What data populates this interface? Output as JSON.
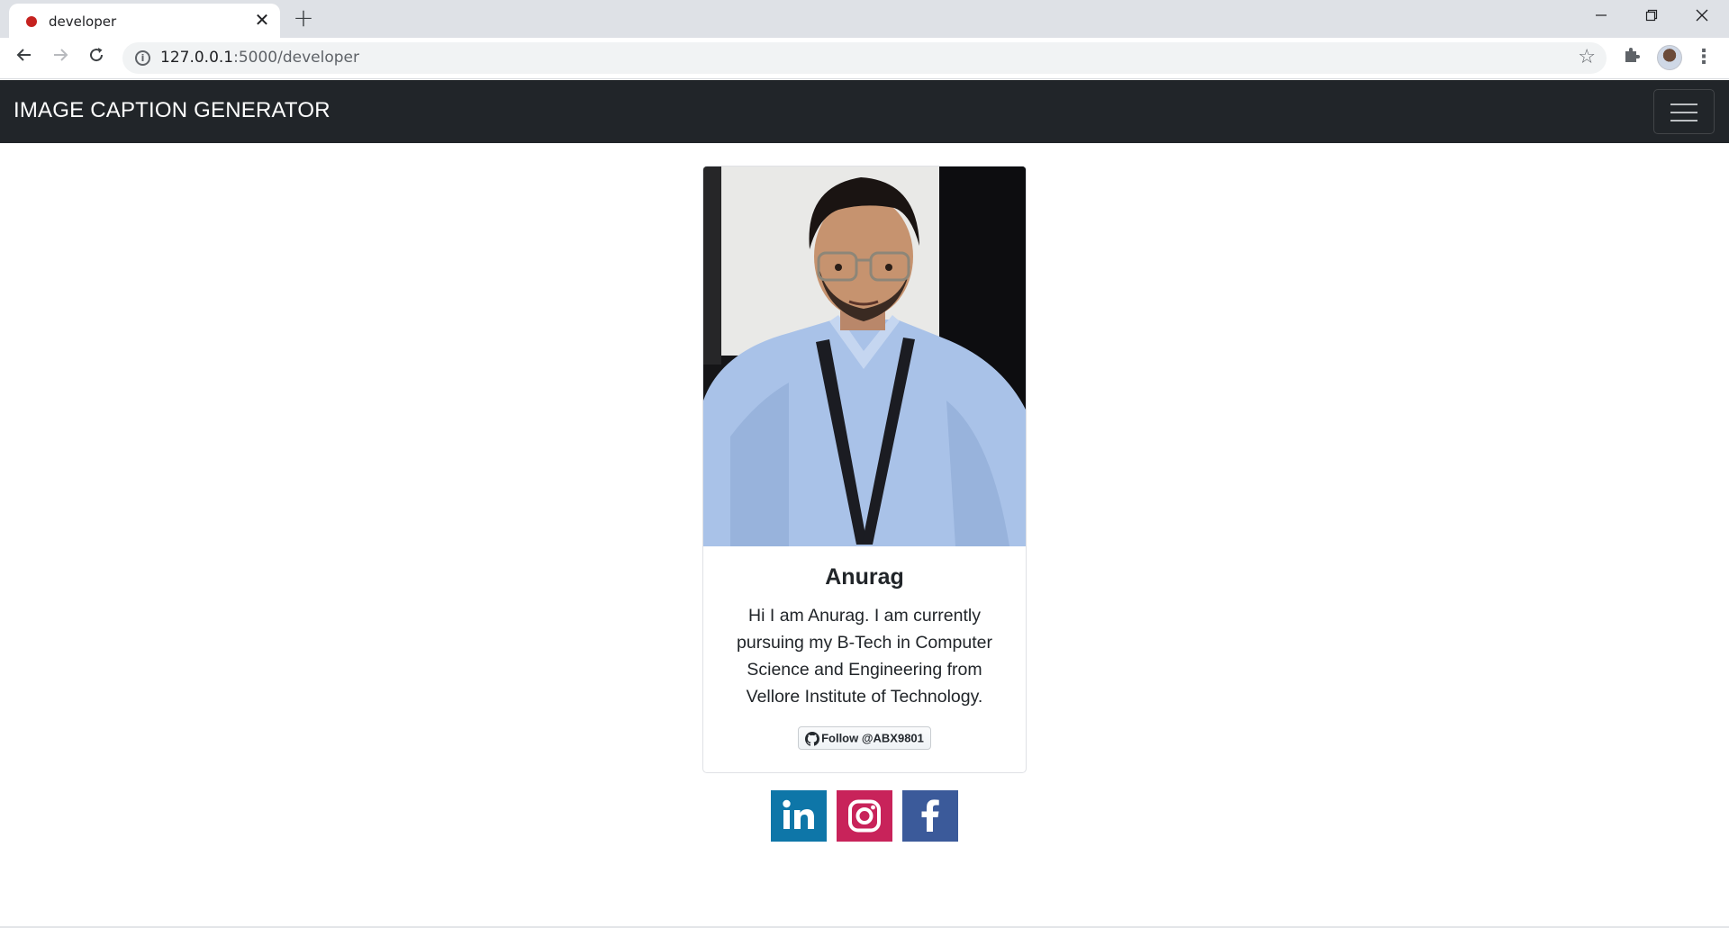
{
  "browser": {
    "tab_title": "developer",
    "tab_close": "✕",
    "new_tab": "+",
    "url_host": "127.0.0.1",
    "url_path": ":5000/developer",
    "colors": {
      "tabstrip": "#dee1e6",
      "favicon": "#c5221f"
    }
  },
  "navbar": {
    "brand": "IMAGE CAPTION GENERATOR",
    "background": "#212529"
  },
  "card": {
    "photo_description_icon": "profile-photo",
    "name": "Anurag",
    "bio": "Hi I am Anurag. I am currently pursuing my B-Tech in Computer Science and Engineering from Vellore Institute of Technology.",
    "github_button": "Follow @ABX9801"
  },
  "social": {
    "linkedin_color": "#0e76a8",
    "instagram_color": "#c8235a",
    "facebook_color": "#3b5a9a"
  }
}
